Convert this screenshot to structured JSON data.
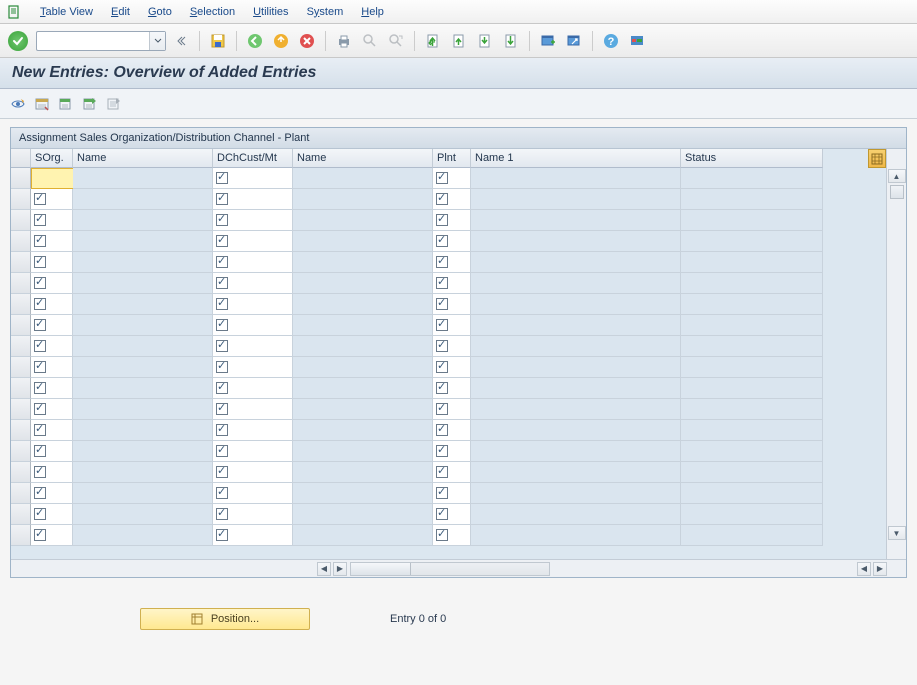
{
  "menu": {
    "items": [
      "Table View",
      "Edit",
      "Goto",
      "Selection",
      "Utilities",
      "System",
      "Help"
    ]
  },
  "title": "New Entries: Overview of Added Entries",
  "panel": {
    "title": "Assignment Sales Organization/Distribution Channel - Plant"
  },
  "columns": {
    "sorg": "SOrg.",
    "name": "Name",
    "dch": "DChCust/Mt",
    "name2": "Name",
    "plnt": "Plnt",
    "name1": "Name 1",
    "status": "Status"
  },
  "footer": {
    "position_label": "Position...",
    "entry_label": "Entry 0 of 0"
  },
  "row_count": 18
}
